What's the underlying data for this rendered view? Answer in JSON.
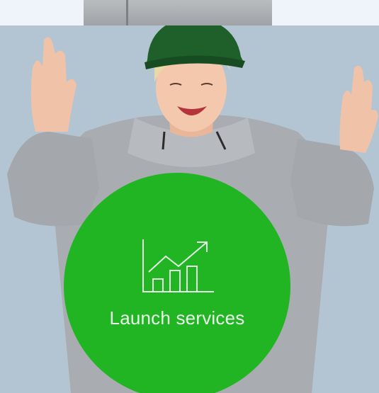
{
  "hero": {
    "service": {
      "label": "Launch services",
      "icon": "growth-chart-icon",
      "color": "#21b524"
    },
    "colors": {
      "background": "#b3c5d3",
      "page": "#eef4fa"
    }
  }
}
